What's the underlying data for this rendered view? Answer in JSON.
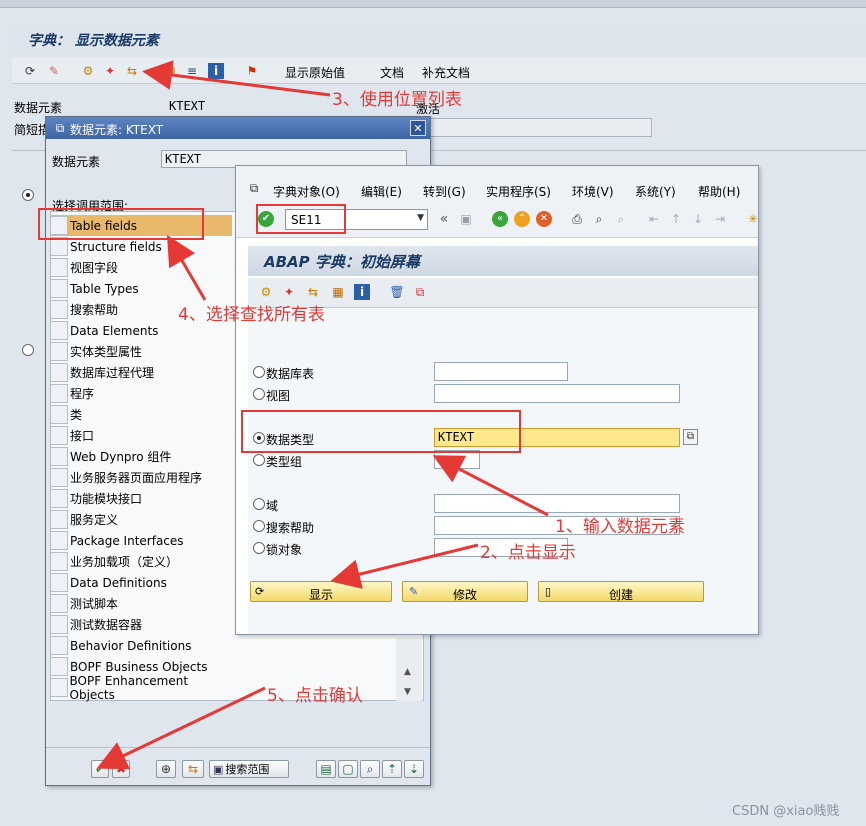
{
  "main": {
    "title": "字典： 显示数据元素",
    "toolbar_show_original": "显示原始值",
    "toolbar_doc": "文档",
    "toolbar_supp_doc": "补充文档",
    "label_data_element": "数据元素",
    "value_data_element": "KTEXT",
    "status_active": "激活",
    "label_short_desc": "简短描"
  },
  "dialog_search": {
    "title": "数据元素: KTEXT",
    "label_data_element": "数据元素",
    "value_data_element": "KTEXT",
    "label_scope": "选择调用范围:",
    "items": [
      "Table fields",
      "Structure fields",
      "视图字段",
      "Table Types",
      "搜索帮助",
      "Data Elements",
      "实体类型属性",
      "数据库过程代理",
      "程序",
      "类",
      "接口",
      "Web Dynpro 组件",
      "业务服务器页面应用程序",
      "功能模块接口",
      "服务定义",
      "Package Interfaces",
      "业务加载项（定义）",
      "Data Definitions",
      "测试脚本",
      "测试数据容器",
      "Behavior Definitions",
      "BOPF Business Objects",
      "BOPF Enhancement Objects"
    ],
    "search_scope_button": "搜索范围"
  },
  "se11": {
    "menu": [
      "字典对象(O)",
      "编辑(E)",
      "转到(G)",
      "实用程序(S)",
      "环境(V)",
      "系统(Y)",
      "帮助(H)"
    ],
    "command_field": "SE11",
    "title": "ABAP 字典：初始屏幕",
    "options": [
      "数据库表",
      "视图",
      "数据类型",
      "类型组",
      "域",
      "搜索帮助",
      "锁对象"
    ],
    "data_type_value": "KTEXT",
    "btn_display": "显示",
    "btn_change": "修改",
    "btn_create": "创建"
  },
  "annotations": {
    "a1": "1、输入数据元素",
    "a2": "2、点击显示",
    "a3": "3、使用位置列表",
    "a4": "4、选择查找所有表",
    "a5": "5、点击确认"
  },
  "watermark": "CSDN @xiao贱贱",
  "colors": {
    "accent_red": "#e53935",
    "selection": "#e8b96a",
    "input_yellow": "#ffe88c",
    "title_text": "#1c3a66"
  }
}
